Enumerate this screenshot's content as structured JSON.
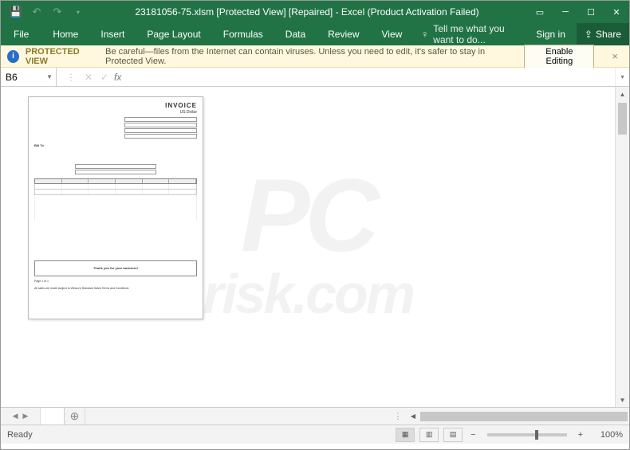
{
  "titlebar": {
    "title": "23181056-75.xlsm  [Protected View] [Repaired] - Excel (Product Activation Failed)"
  },
  "tabs": {
    "file": "File",
    "items": [
      "Home",
      "Insert",
      "Page Layout",
      "Formulas",
      "Data",
      "Review",
      "View"
    ],
    "tellme_placeholder": "Tell me what you want to do...",
    "signin": "Sign in",
    "share": "Share"
  },
  "protected_view": {
    "title": "PROTECTED VIEW",
    "message": "Be careful—files from the Internet can contain viruses. Unless you need to edit, it's safer to stay in Protected View.",
    "button": "Enable Editing"
  },
  "formula_bar": {
    "cell_ref": "B6",
    "fx": "fx",
    "value": ""
  },
  "invoice": {
    "heading": "INVOICE",
    "subheading": "US Dollar",
    "billto": "Bill To",
    "thanks": "Thank you for your business!",
    "footer1": "Page 1 of 1",
    "footer2": "All sales are made subject to Wesco's Standard Sales Terms and Conditions"
  },
  "watermark": {
    "line1": "PC",
    "line2": "risk.com"
  },
  "status": {
    "ready": "Ready",
    "zoom_label": "100%",
    "minus": "−",
    "plus": "+"
  }
}
